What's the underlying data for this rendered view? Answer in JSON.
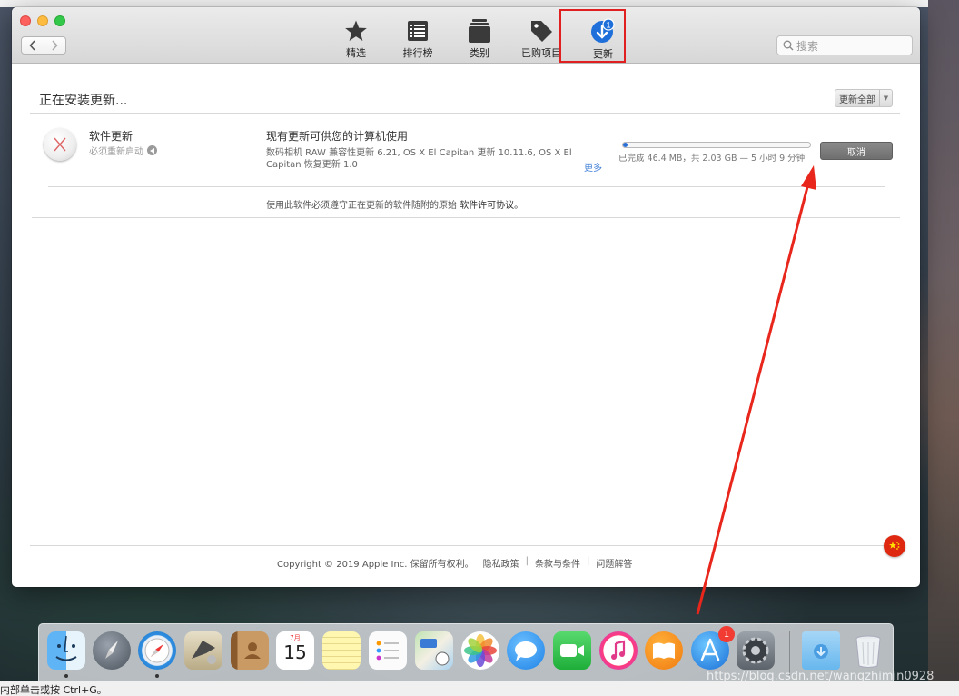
{
  "toolbar": {
    "items": [
      {
        "label": "精选",
        "icon": "star-icon"
      },
      {
        "label": "排行榜",
        "icon": "list-icon"
      },
      {
        "label": "类别",
        "icon": "stack-icon"
      },
      {
        "label": "已购项目",
        "icon": "tag-icon"
      },
      {
        "label": "更新",
        "icon": "updates-icon",
        "badge": "1",
        "selected": true
      }
    ]
  },
  "search": {
    "placeholder": "搜索"
  },
  "main": {
    "section_title": "正在安装更新...",
    "update_all_label": "更新全部"
  },
  "update": {
    "app_name": "软件更新",
    "app_sub": "必须重新启动",
    "title": "现有更新可供您的计算机使用",
    "description": "数码相机 RAW 兼容性更新 6.21, OS X El Capitan 更新 10.11.6, OS X El Capitan 恢复更新 1.0",
    "more_label": "更多",
    "progress_fraction": 0.023,
    "progress_text": "已完成 46.4 MB，共 2.03 GB — 5 小时 9 分钟",
    "cancel_label": "取消"
  },
  "license": {
    "text": "使用此软件必须遵守正在更新的软件随附的原始",
    "link": "软件许可协议。"
  },
  "footer": {
    "copyright": "Copyright © 2019 Apple Inc. 保留所有权利。",
    "privacy": "隐私政策",
    "terms": "条款与条件",
    "help": "问题解答",
    "sep": "|"
  },
  "dock": {
    "apps": [
      "finder-icon",
      "launchpad-icon",
      "safari-icon",
      "mail-icon",
      "contacts-icon",
      "calendar-icon",
      "notes-icon",
      "reminders-icon",
      "maps-icon",
      "photos-icon",
      "messages-icon",
      "facetime-icon",
      "itunes-icon",
      "ibooks-icon",
      "app-store-icon",
      "system-preferences-icon",
      "downloads-folder-icon",
      "trash-icon"
    ],
    "calendar_month": "7月",
    "calendar_day": "15",
    "app_store_badge": "1"
  },
  "watermark": "https://blog.csdn.net/wangzhimin0928",
  "statusbar": "内部单击或按 Ctrl+G。",
  "colors": {
    "accent": "#2a6fd6",
    "highlight": "#e02020"
  }
}
